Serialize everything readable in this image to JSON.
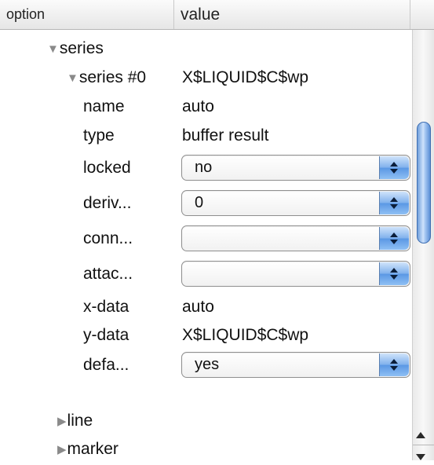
{
  "header": {
    "option_label": "option",
    "value_label": "value"
  },
  "tree": {
    "series_label": "series",
    "series0_label": "series #0",
    "series0_value": "X$LIQUID$C$wp",
    "rows": {
      "name": {
        "label": "name",
        "value": "auto"
      },
      "type": {
        "label": "type",
        "value": "buffer result"
      },
      "locked": {
        "label": "locked",
        "value": "no"
      },
      "deriv": {
        "label": "deriv...",
        "value": "0"
      },
      "conn": {
        "label": "conn...",
        "value": ""
      },
      "attac": {
        "label": "attac...",
        "value": ""
      },
      "xdata": {
        "label": "x-data",
        "value": "auto"
      },
      "ydata": {
        "label": "y-data",
        "value": "X$LIQUID$C$wp"
      },
      "defa": {
        "label": "defa...",
        "value": "yes"
      }
    },
    "line_label": "line",
    "marker_label": "marker"
  },
  "icons": {
    "expanded": "disclosure-triangle-down-icon",
    "collapsed": "disclosure-triangle-right-icon",
    "select_arrows": "up-down-chevron-icon"
  },
  "colors": {
    "select_button": "#6aa4ea",
    "scroll_thumb": "#8fb8ee"
  }
}
